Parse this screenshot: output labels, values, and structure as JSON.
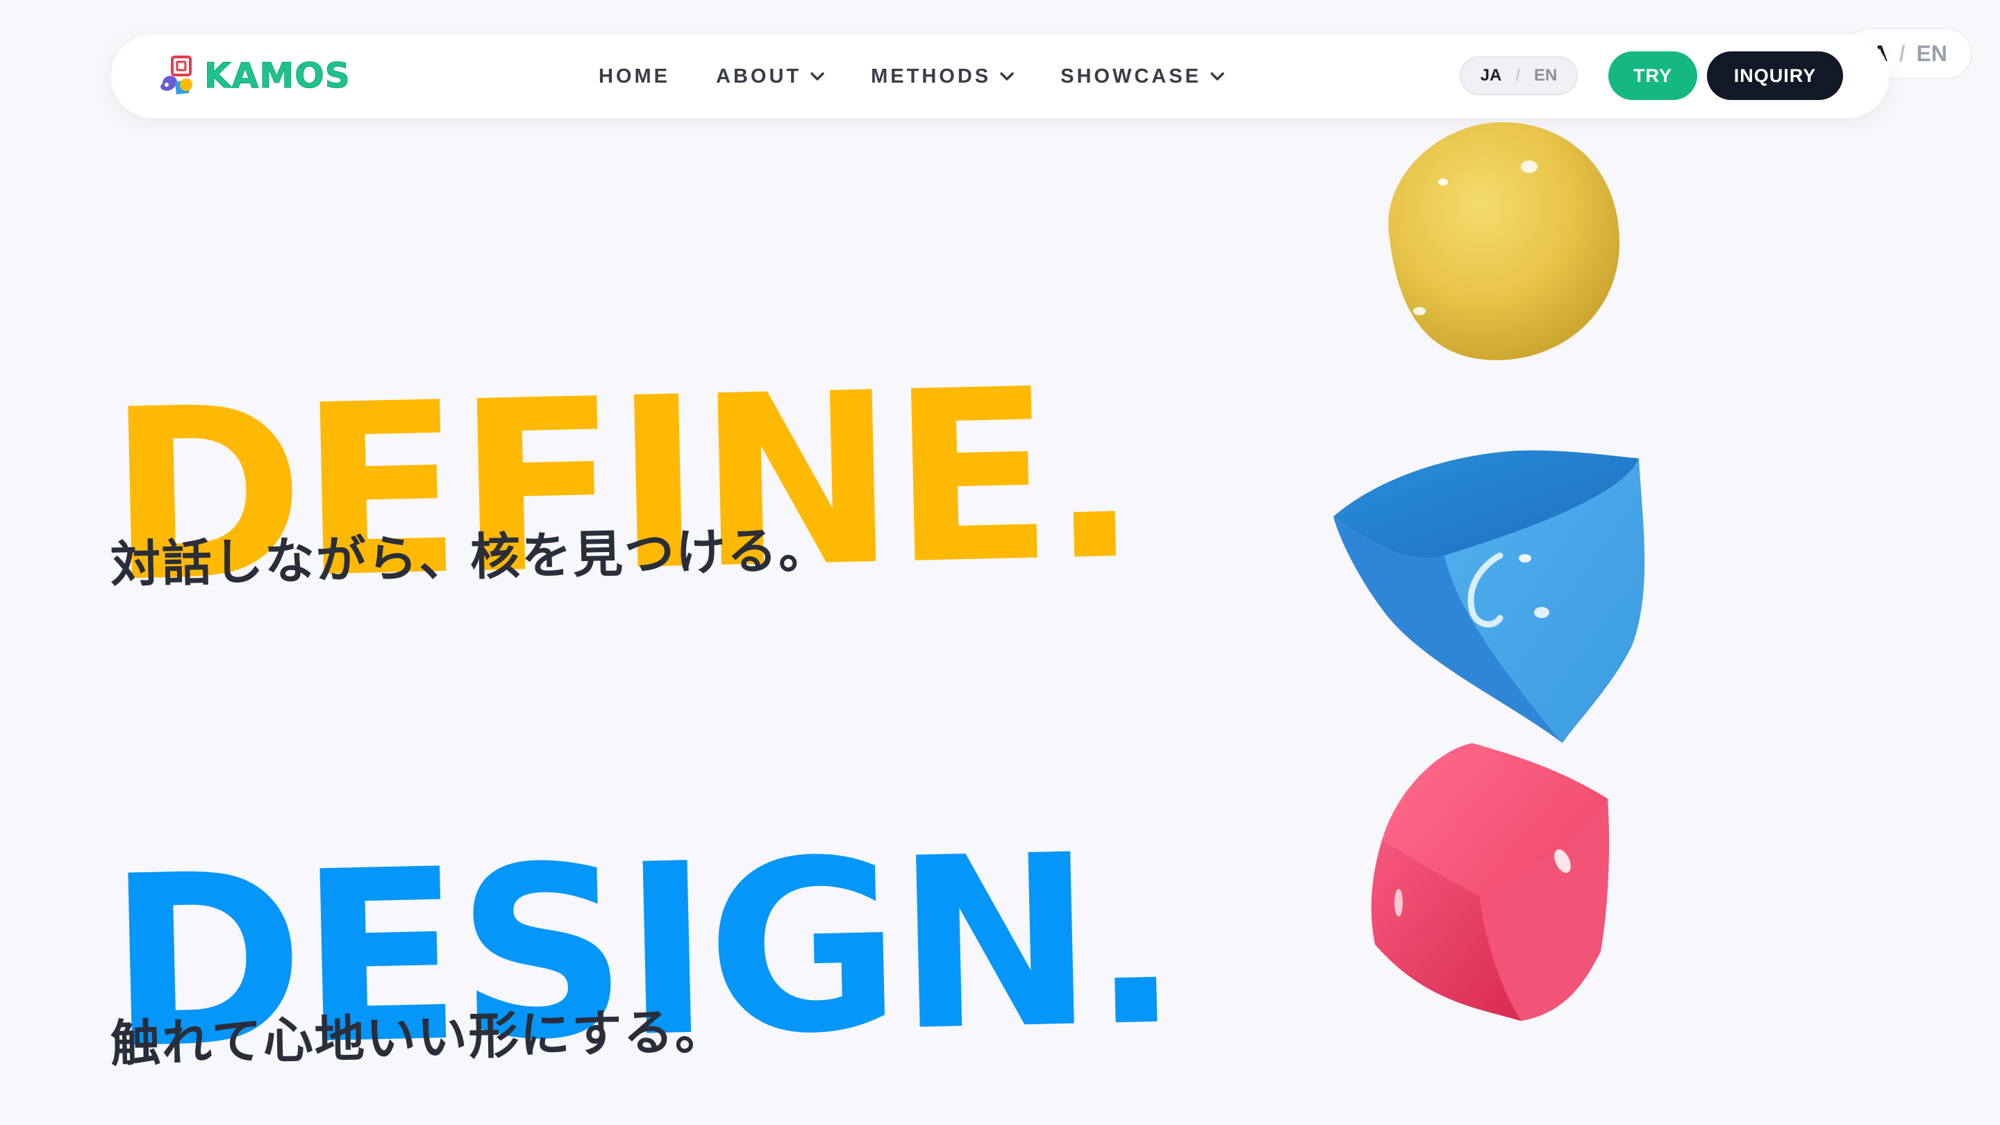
{
  "header": {
    "logo_text": "KAMOS",
    "nav": [
      {
        "label": "HOME",
        "has_dropdown": false
      },
      {
        "label": "ABOUT",
        "has_dropdown": true
      },
      {
        "label": "METHODS",
        "has_dropdown": true
      },
      {
        "label": "SHOWCASE",
        "has_dropdown": true
      }
    ],
    "language": {
      "ja": "JA",
      "separator": "/",
      "en": "EN",
      "active": "JA"
    },
    "try_label": "TRY",
    "inquiry_label": "INQUIRY"
  },
  "floating_language": {
    "ja": "A",
    "separator": "/",
    "en": "EN"
  },
  "hero": {
    "define_title": "DEFINE.",
    "define_subtitle": "対話しながら、核を見つける。",
    "design_title": "DESIGN.",
    "design_subtitle": "触れて心地いい形にする。"
  },
  "colors": {
    "background": "#f8f7fb",
    "brand_green": "#15b97f",
    "define_yellow": "#ffb903",
    "design_blue": "#0596f9",
    "dark": "#111827",
    "shape_pink": "#f0476f"
  },
  "icons": {
    "logo": "kamos-logo-icon",
    "dropdown": "chevron-down-icon"
  }
}
